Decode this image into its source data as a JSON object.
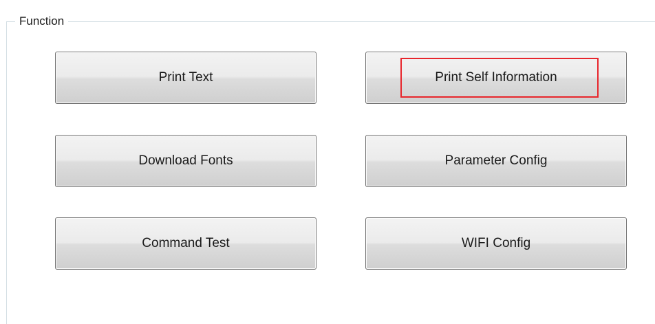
{
  "group": {
    "title": "Function"
  },
  "buttons": {
    "print_text": "Print Text",
    "print_self_information": "Print Self Information",
    "download_fonts": "Download Fonts",
    "parameter_config": "Parameter Config",
    "command_test": "Command Test",
    "wifi_config": "WIFI Config"
  },
  "annotation": {
    "highlight_color": "#e8262c"
  }
}
